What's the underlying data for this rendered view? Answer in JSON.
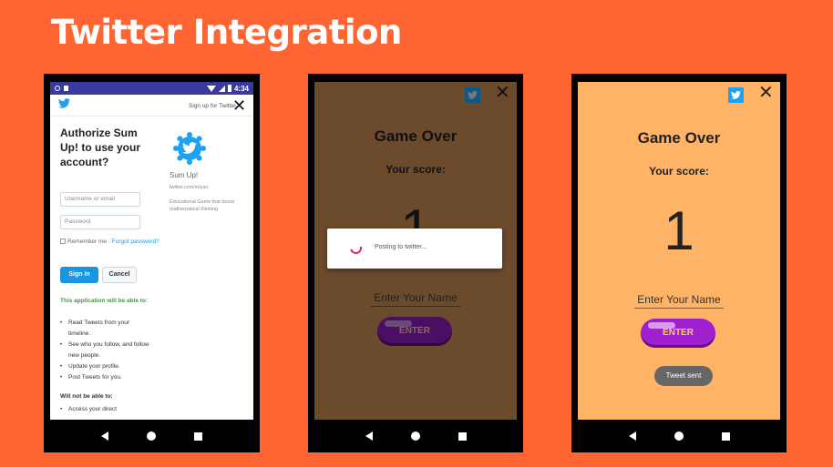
{
  "slide": {
    "title": "Twitter Integration"
  },
  "phone1": {
    "status_time": "4:34",
    "signup_link": "Sign up for Twitter",
    "close_glyph": "✕",
    "auth_title": "Authorize Sum Up! to use your account?",
    "username_placeholder": "Username or email",
    "password_placeholder": "Password",
    "remember_label": "Remember me ·",
    "forgot_link": "Forgot password?",
    "signin_label": "Sign In",
    "cancel_label": "Cancel",
    "permissions_heading": "This application will be able to:",
    "permissions": [
      "Read Tweets from your timeline.",
      "See who you follow, and follow new people.",
      "Update your profile.",
      "Post Tweets for you."
    ],
    "not_able_heading": "Will not be able to:",
    "not_able": [
      "Access your direct"
    ],
    "app_name": "Sum Up!",
    "app_url": "twitter.com/sriyan",
    "app_description": "Educational Game that boost mathematical thinking"
  },
  "phone2": {
    "close_glyph": "✕",
    "title": "Game Over",
    "score_label": "Your score:",
    "score": "1",
    "name_placeholder": "Enter Your Name",
    "enter_label": "ENTER",
    "dialog_text": "Posting to twitter..."
  },
  "phone3": {
    "close_glyph": "✕",
    "title": "Game Over",
    "score_label": "Your score:",
    "score": "1",
    "name_placeholder": "Enter Your Name",
    "enter_label": "ENTER",
    "toast": "Tweet sent"
  },
  "icons": {
    "twitter": "twitter-bird-icon",
    "back": "nav-back-icon",
    "home": "nav-home-icon",
    "recent": "nav-recent-icon"
  },
  "colors": {
    "slide_bg": "#FF6533",
    "twitter_blue": "#1DA1F2",
    "game_bg_dim": "#6C4A2C",
    "game_bg": "#FFB366",
    "enter_purple": "#9C1FC7",
    "spinner": "#E91E63"
  }
}
